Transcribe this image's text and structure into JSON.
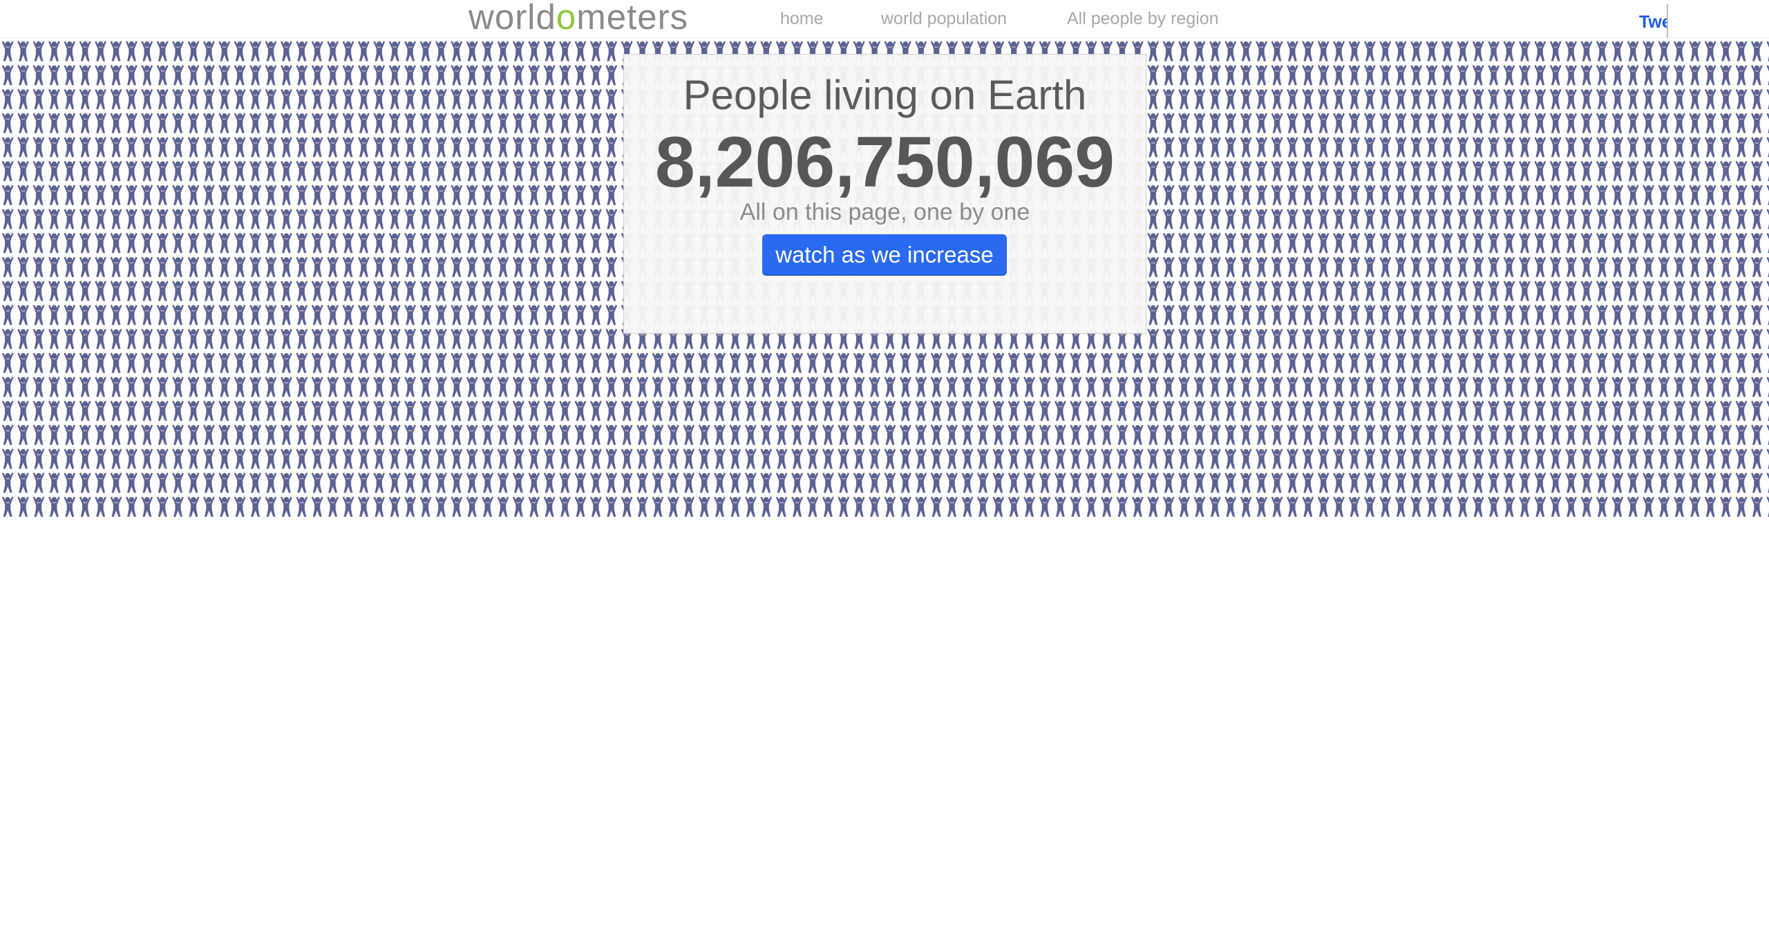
{
  "header": {
    "logo": {
      "before": "world",
      "highlight": "o",
      "after": "meters"
    },
    "nav": [
      {
        "label": "home"
      },
      {
        "label": "world population"
      },
      {
        "label": "All people by region"
      }
    ],
    "tweet_label": "Twe"
  },
  "people_grid": {
    "icon": "person-arms-up-icon",
    "color": "#5a6291"
  },
  "card": {
    "title": "People living on Earth",
    "count": "8,206,750,069",
    "subtitle": "All on this page, one by one",
    "button_label": "watch as we increase"
  },
  "colors": {
    "logo_text": "#8a8a8a",
    "logo_accent": "#8cc63f",
    "nav_text": "#a8a8a8",
    "button_bg": "#2a6af2",
    "tweet": "#1a5be6"
  }
}
